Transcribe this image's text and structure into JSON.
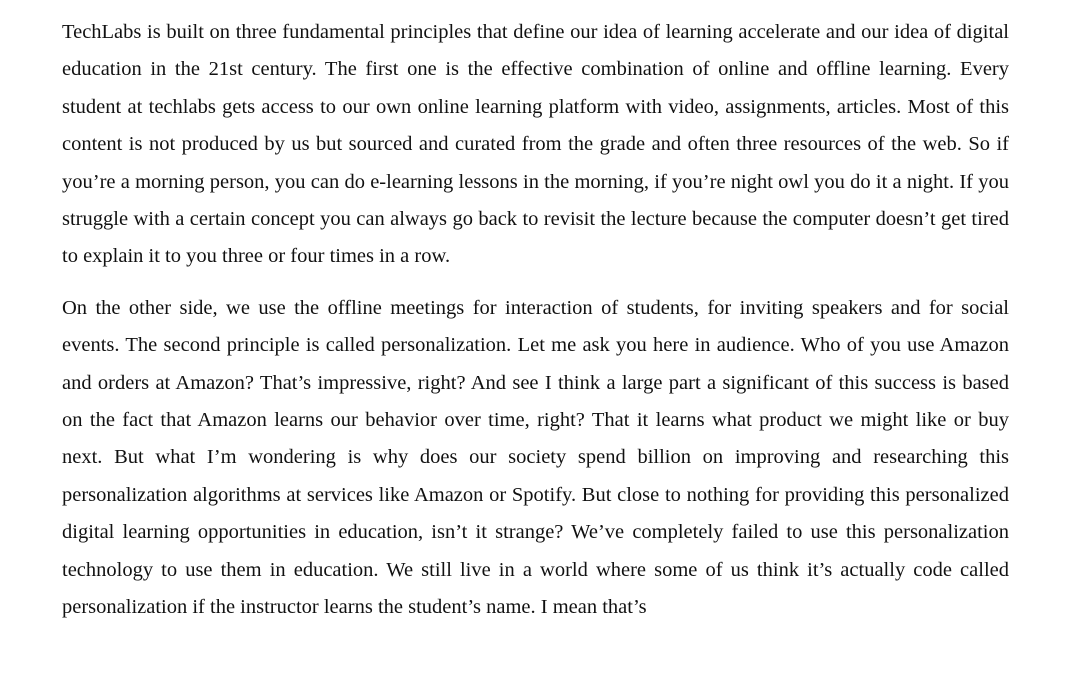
{
  "document": {
    "paragraphs": [
      "TechLabs is built on three fundamental principles that define our idea of learning accelerate and our idea of digital education in the 21st century. The first one is the effective combination of online and offline learning. Every student at techlabs gets access to our own online learning platform with video, assignments, articles. Most of this content is not produced by us but sourced and curated from the grade and often three resources of the web. So if you’re a morning person, you can do e-learning lessons in the morning, if you’re night owl you do it a night. If you struggle with a certain concept you can always go back to revisit the lecture because the computer doesn’t get tired to explain it to you three or four times in a row.",
      "On the other side, we use the offline meetings for interaction of students, for inviting speakers and for social events. The second principle is called personalization. Let me ask you here in audience. Who of you use Amazon and orders at Amazon? That’s impressive, right? And see I think a large part a significant of this success is based on the fact that Amazon learns our behavior over time, right? That it learns what product we might like or buy next. But what I’m wondering is why does our society spend billion on improving and researching this personalization algorithms at services like Amazon or Spotify. But close to nothing for providing this personalized digital learning opportunities in education, isn’t it strange? We’ve completely failed to use this personalization technology to use them in education. We still live in a world where some of us think it’s actually code called personalization if the instructor learns the student’s name. I mean that’s"
    ]
  }
}
